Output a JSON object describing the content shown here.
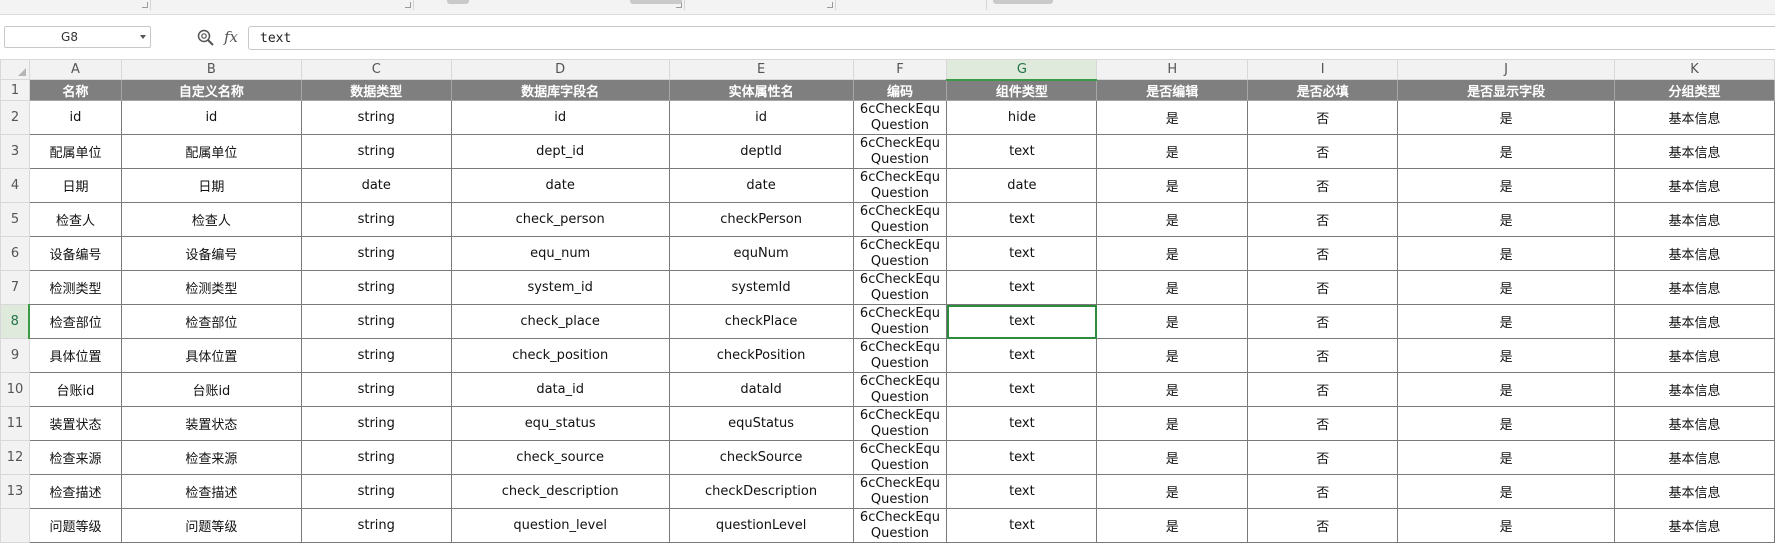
{
  "formula_bar": {
    "cell_ref": "G8",
    "fx_label": "fx",
    "content": "text"
  },
  "sheet": {
    "columns": [
      "A",
      "B",
      "C",
      "D",
      "E",
      "F",
      "G",
      "H",
      "I",
      "J",
      "K"
    ],
    "selected_column": "G",
    "selected_row": "8",
    "row_numbers": [
      "1",
      "2",
      "3",
      "4",
      "5",
      "6",
      "7",
      "8",
      "9",
      "10",
      "11",
      "12",
      "13"
    ],
    "header_row": [
      "名称",
      "自定义名称",
      "数据类型",
      "数据库字段名",
      "实体属性名",
      "编码",
      "组件类型",
      "是否编辑",
      "是否必填",
      "是否显示字段",
      "分组类型"
    ],
    "rows": [
      [
        "id",
        "id",
        "string",
        "id",
        "id",
        "6cCheckEquQuestion",
        "hide",
        "是",
        "否",
        "是",
        "基本信息"
      ],
      [
        "配属单位",
        "配属单位",
        "string",
        "dept_id",
        "deptId",
        "6cCheckEquQuestion",
        "text",
        "是",
        "否",
        "是",
        "基本信息"
      ],
      [
        "日期",
        "日期",
        "date",
        "date",
        "date",
        "6cCheckEquQuestion",
        "date",
        "是",
        "否",
        "是",
        "基本信息"
      ],
      [
        "检查人",
        "检查人",
        "string",
        "check_person",
        "checkPerson",
        "6cCheckEquQuestion",
        "text",
        "是",
        "否",
        "是",
        "基本信息"
      ],
      [
        "设备编号",
        "设备编号",
        "string",
        "equ_num",
        "equNum",
        "6cCheckEquQuestion",
        "text",
        "是",
        "否",
        "是",
        "基本信息"
      ],
      [
        "检测类型",
        "检测类型",
        "string",
        "system_id",
        "systemId",
        "6cCheckEquQuestion",
        "text",
        "是",
        "否",
        "是",
        "基本信息"
      ],
      [
        "检查部位",
        "检查部位",
        "string",
        "check_place",
        "checkPlace",
        "6cCheckEquQuestion",
        "text",
        "是",
        "否",
        "是",
        "基本信息"
      ],
      [
        "具体位置",
        "具体位置",
        "string",
        "check_position",
        "checkPosition",
        "6cCheckEquQuestion",
        "text",
        "是",
        "否",
        "是",
        "基本信息"
      ],
      [
        "台账id",
        "台账id",
        "string",
        "data_id",
        "dataId",
        "6cCheckEquQuestion",
        "text",
        "是",
        "否",
        "是",
        "基本信息"
      ],
      [
        "装置状态",
        "装置状态",
        "string",
        "equ_status",
        "equStatus",
        "6cCheckEquQuestion",
        "text",
        "是",
        "否",
        "是",
        "基本信息"
      ],
      [
        "检查来源",
        "检查来源",
        "string",
        "check_source",
        "checkSource",
        "6cCheckEquQuestion",
        "text",
        "是",
        "否",
        "是",
        "基本信息"
      ],
      [
        "检查描述",
        "检查描述",
        "string",
        "check_description",
        "checkDescription",
        "6cCheckEquQuestion",
        "text",
        "是",
        "否",
        "是",
        "基本信息"
      ],
      [
        "问题等级",
        "问题等级",
        "string",
        "question_level",
        "questionLevel",
        "6cCheckEquQuestion",
        "text",
        "是",
        "否",
        "是",
        "基本信息"
      ]
    ]
  }
}
